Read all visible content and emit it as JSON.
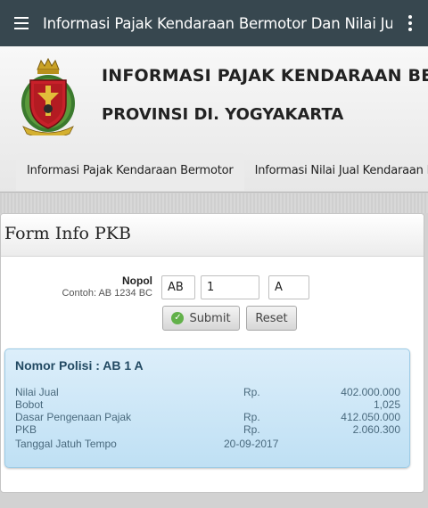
{
  "appbar": {
    "title": "Informasi Pajak Kendaraan Bermotor Dan Nilai Jual...",
    "menu_icon": "hamburger-menu-icon",
    "more_icon": "more-vertical-icon"
  },
  "header": {
    "title_line1": "INFORMASI PAJAK KENDARAAN BERMOTOR",
    "title_line2": "PROVINSI DI. YOGYAKARTA",
    "logo_icon": "yogyakarta-emblem",
    "tabs": [
      {
        "label": "Informasi Pajak Kendaraan Bermotor",
        "active": true
      },
      {
        "label": "Informasi Nilai Jual Kendaraan Bermotor",
        "active": false
      }
    ]
  },
  "form": {
    "heading": "Form Info PKB",
    "nopol_label": "Nopol",
    "nopol_example": "Contoh: AB 1234 BC",
    "nopol_prefix": "AB",
    "nopol_number": "1",
    "nopol_suffix": "A",
    "submit_label": "Submit",
    "reset_label": "Reset"
  },
  "result": {
    "title": "Nomor Polisi : AB 1 A",
    "nilai_jual_label": "Nilai Jual",
    "nilai_jual_currency": "Rp.",
    "nilai_jual_value": "402.000.000",
    "bobot_label": "Bobot",
    "bobot_value": "1,025",
    "dpp_label": "Dasar Pengenaan Pajak",
    "dpp_currency": "Rp.",
    "dpp_value": "412.050.000",
    "pkb_label": "PKB",
    "pkb_currency": "Rp.",
    "pkb_value": "2.060.300",
    "jatuh_tempo_label": "Tanggal Jatuh Tempo",
    "jatuh_tempo_value": "20-09-2017"
  },
  "colors": {
    "appbar": "#37474f",
    "result_bg": "#cfe8f7",
    "submit_icon": "#62b14a"
  }
}
